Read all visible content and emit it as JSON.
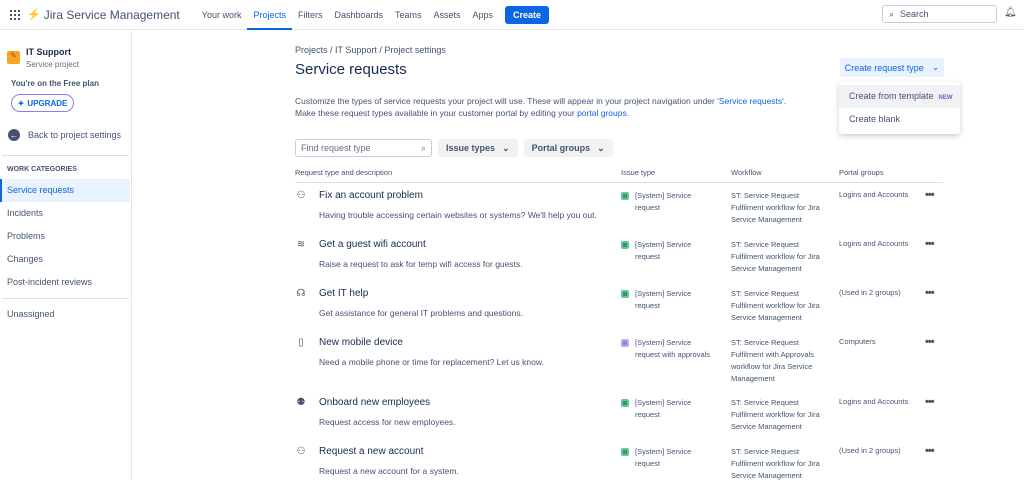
{
  "topbar": {
    "product": "Jira Service Management",
    "nav": [
      "Your work",
      "Projects",
      "Filters",
      "Dashboards",
      "Teams",
      "Assets",
      "Apps"
    ],
    "create": "Create",
    "search_placeholder": "Search"
  },
  "sidebar": {
    "project_name": "IT Support",
    "project_type": "Service project",
    "plan": "You're on the Free plan",
    "upgrade": "UPGRADE",
    "back": "Back to project settings",
    "category": "WORK CATEGORIES",
    "items": [
      "Service requests",
      "Incidents",
      "Problems",
      "Changes",
      "Post-incident reviews"
    ],
    "unassigned": "Unassigned"
  },
  "main": {
    "breadcrumb": "Projects  /  IT Support  /  Project settings",
    "title": "Service requests",
    "desc1": "Customize the types of service requests your project will use. These will appear in your project navigation under ",
    "desc1_link": "'Service requests'",
    "desc1_end": ".",
    "desc2": "Make these request types available in your customer portal by editing your ",
    "desc2_link": "portal groups",
    "desc2_end": ".",
    "create_request_type": "Create request type",
    "menu": {
      "from_template": "Create from template",
      "new_badge": "NEW",
      "blank": "Create blank"
    },
    "find_placeholder": "Find request type",
    "issue_types": "Issue types",
    "portal_groups": "Portal groups",
    "columns": [
      "Request type and description",
      "Issue type",
      "Workflow",
      "Portal groups"
    ],
    "rows": [
      {
        "icon": "account-problem-icon",
        "glyph": "⚇",
        "name": "Fix an account problem",
        "desc": "Having trouble accessing certain websites or systems? We'll help you out.",
        "issue1": "[System] Service",
        "issue2": "request",
        "issue_color": "green",
        "wf": [
          "ST: Service Request",
          "Fulfilment workflow for Jira",
          "Service Management"
        ],
        "portal": "Logins and Accounts"
      },
      {
        "icon": "wifi-icon",
        "glyph": "≋",
        "name": "Get a guest wifi account",
        "desc": "Raise a request to ask for temp wifi access for guests.",
        "issue1": "[System] Service",
        "issue2": "request",
        "issue_color": "green",
        "wf": [
          "ST: Service Request",
          "Fulfilment workflow for Jira",
          "Service Management"
        ],
        "portal": "Logins and Accounts"
      },
      {
        "icon": "headset-icon",
        "glyph": "☊",
        "name": "Get IT help",
        "desc": "Get assistance for general IT problems and questions.",
        "issue1": "[System] Service",
        "issue2": "request",
        "issue_color": "green",
        "wf": [
          "ST: Service Request",
          "Fulfilment workflow for Jira",
          "Service Management"
        ],
        "portal": "(Used in 2 groups)"
      },
      {
        "icon": "mobile-device-icon",
        "glyph": "▯",
        "name": "New mobile device",
        "desc": "Need a mobile phone or time for replacement? Let us know.",
        "issue1": "[System] Service",
        "issue2": "request with approvals",
        "issue_color": "purple",
        "wf": [
          "ST: Service Request",
          "Fulfilment with Approvals",
          "workflow for Jira Service",
          "Management"
        ],
        "portal": "Computers"
      },
      {
        "icon": "people-icon",
        "glyph": "⚉",
        "name": "Onboard new employees",
        "desc": "Request access for new employees.",
        "issue1": "[System] Service",
        "issue2": "request",
        "issue_color": "green",
        "wf": [
          "ST: Service Request",
          "Fulfilment workflow for Jira",
          "Service Management"
        ],
        "portal": "Logins and Accounts"
      },
      {
        "icon": "new-account-icon",
        "glyph": "⚇",
        "name": "Request a new account",
        "desc": "Request a new account for a system.",
        "issue1": "[System] Service",
        "issue2": "request",
        "issue_color": "green",
        "wf": [
          "ST: Service Request",
          "Fulfilment workflow for Jira",
          "Service Management"
        ],
        "portal": "(Used in 2 groups)"
      }
    ]
  }
}
